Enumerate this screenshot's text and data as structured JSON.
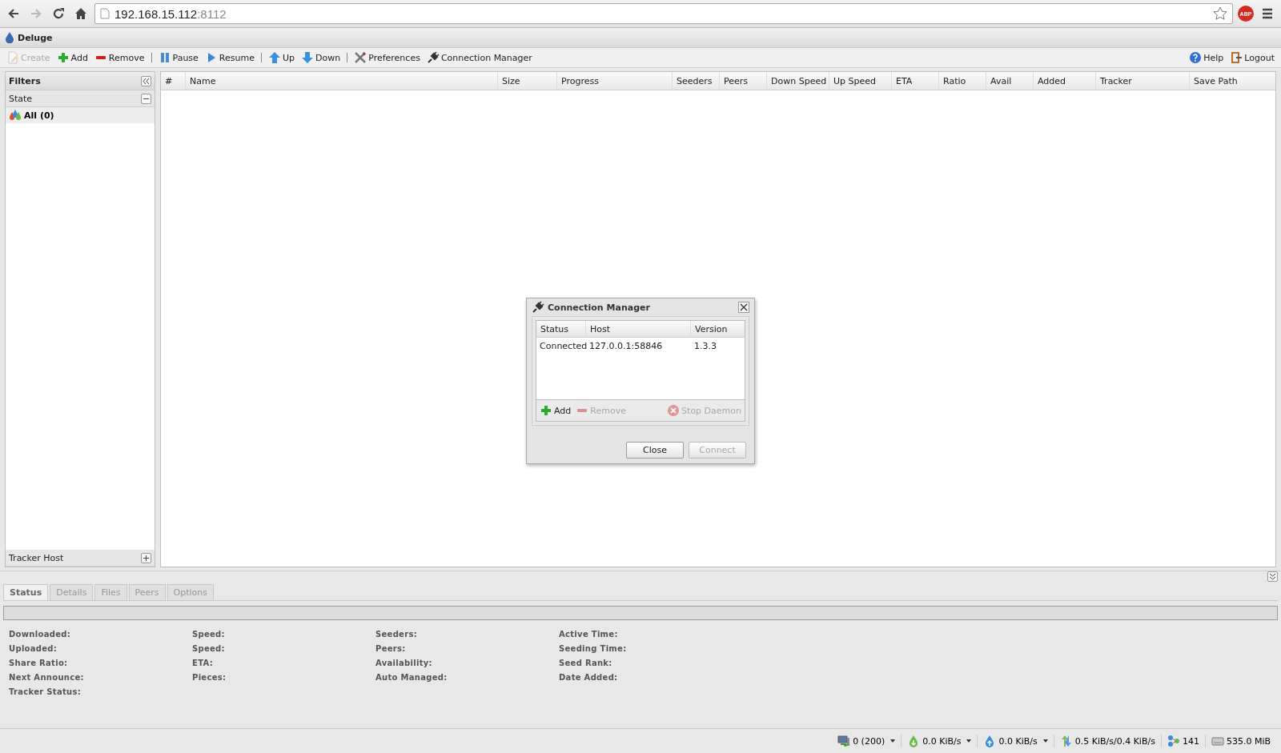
{
  "browser": {
    "url_host": "192.168.15.112",
    "url_port": ":8112",
    "extension_label": "ABP"
  },
  "app": {
    "title": "Deluge"
  },
  "toolbar": [
    {
      "label": "Create",
      "kind": "create",
      "disabled": true,
      "separator_before": false
    },
    {
      "label": "Add",
      "kind": "add",
      "disabled": false,
      "separator_before": false
    },
    {
      "label": "Remove",
      "kind": "remove",
      "disabled": false,
      "separator_before": false
    },
    {
      "label": "Pause",
      "kind": "pause",
      "disabled": false,
      "separator_before": true
    },
    {
      "label": "Resume",
      "kind": "resume",
      "disabled": false,
      "separator_before": false
    },
    {
      "label": "Up",
      "kind": "up",
      "disabled": false,
      "separator_before": true
    },
    {
      "label": "Down",
      "kind": "down",
      "disabled": false,
      "separator_before": false
    },
    {
      "label": "Preferences",
      "kind": "preferences",
      "disabled": false,
      "separator_before": true
    },
    {
      "label": "Connection Manager",
      "kind": "plug",
      "disabled": false,
      "separator_before": false
    }
  ],
  "toolbar_right": [
    {
      "label": "Help",
      "kind": "help"
    },
    {
      "label": "Logout",
      "kind": "logout"
    }
  ],
  "sidebar": {
    "title": "Filters",
    "sections": [
      {
        "title": "State",
        "expanded": true,
        "items": [
          {
            "label": "All (0)",
            "selected": true
          }
        ]
      },
      {
        "title": "Tracker Host",
        "expanded": false
      }
    ]
  },
  "table": {
    "columns": [
      "#",
      "Name",
      "Size",
      "Progress",
      "Seeders",
      "Peers",
      "Down Speed",
      "Up Speed",
      "ETA",
      "Ratio",
      "Avail",
      "Added",
      "Tracker",
      "Save Path"
    ]
  },
  "details": {
    "tabs": [
      {
        "label": "Status",
        "selected": true
      },
      {
        "label": "Details",
        "selected": false
      },
      {
        "label": "Files",
        "selected": false
      },
      {
        "label": "Peers",
        "selected": false
      },
      {
        "label": "Options",
        "selected": false
      }
    ],
    "progress": {
      "level": 0
    },
    "fields": [
      [
        "Downloaded:",
        "Uploaded:",
        "Share Ratio:",
        "Next Announce:",
        "Tracker Status:"
      ],
      [
        "Speed:",
        "Speed:",
        "ETA:",
        "Pieces:"
      ],
      [
        "Seeders:",
        "Peers:",
        "Availability:",
        "Auto Managed:"
      ],
      [
        "Active Time:",
        "Seeding Time:",
        "Seed Rank:",
        "Date Added:"
      ]
    ]
  },
  "status_bar": [
    {
      "kind": "connections",
      "text": "0 (200)",
      "dropdown": true
    },
    {
      "kind": "download",
      "text": "0.0 KiB/s",
      "dropdown": true
    },
    {
      "kind": "upload",
      "text": "0.0 KiB/s",
      "dropdown": true
    },
    {
      "kind": "traffic",
      "text": "0.5 KiB/s/0.4 KiB/s",
      "dropdown": false
    },
    {
      "kind": "dht",
      "text": "141",
      "dropdown": false
    },
    {
      "kind": "disk",
      "text": "535.0 MiB",
      "dropdown": false
    }
  ],
  "dialog": {
    "title": "Connection Manager",
    "columns": [
      "Status",
      "Host",
      "Version"
    ],
    "rows": [
      {
        "status": "Connected",
        "host": "127.0.0.1:58846",
        "version": "1.3.3",
        "selected": false
      }
    ],
    "actions": [
      {
        "label": "Add",
        "kind": "add",
        "disabled": false
      },
      {
        "label": "Remove",
        "kind": "remove",
        "disabled": true
      },
      {
        "label": "Stop Daemon",
        "kind": "stop",
        "disabled": true
      }
    ],
    "buttons": [
      {
        "label": "Close",
        "disabled": false
      },
      {
        "label": "Connect",
        "disabled": true
      }
    ]
  }
}
